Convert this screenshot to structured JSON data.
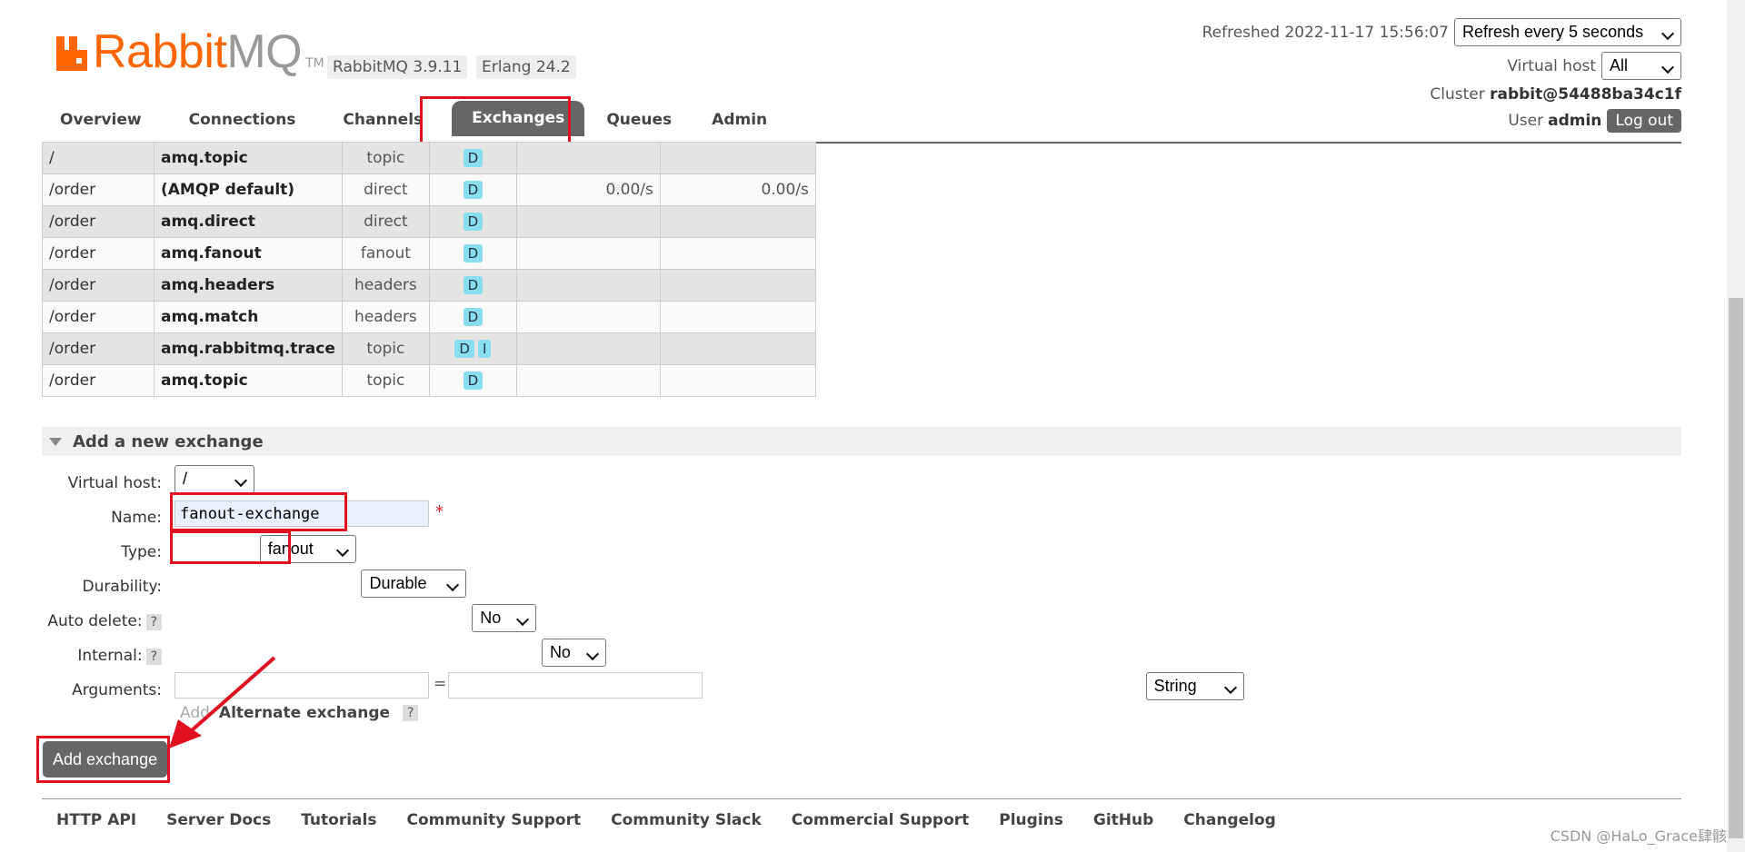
{
  "header": {
    "logo_rabbit": "Rabbit",
    "logo_mq": "MQ",
    "logo_tm": "TM",
    "version_badge": "RabbitMQ 3.9.11",
    "erlang_badge": "Erlang 24.2",
    "refreshed_label": "Refreshed 2022-11-17 15:56:07",
    "refresh_select": "Refresh every 5 seconds",
    "virtual_host_label": "Virtual host",
    "virtual_host_value": "All",
    "cluster_label": "Cluster",
    "cluster_value": "rabbit@54488ba34c1f",
    "user_label": "User",
    "user_value": "admin",
    "logout_label": "Log out"
  },
  "tabs": [
    {
      "label": "Overview",
      "active": false
    },
    {
      "label": "Connections",
      "active": false
    },
    {
      "label": "Channels",
      "active": false
    },
    {
      "label": "Exchanges",
      "active": true
    },
    {
      "label": "Queues",
      "active": false
    },
    {
      "label": "Admin",
      "active": false
    }
  ],
  "exchanges": {
    "rows": [
      {
        "vhost": "/",
        "name": "amq.topic",
        "type": "topic",
        "features": [
          "D"
        ],
        "rate_in": "",
        "rate_out": ""
      },
      {
        "vhost": "/order",
        "name": "(AMQP default)",
        "type": "direct",
        "features": [
          "D"
        ],
        "rate_in": "0.00/s",
        "rate_out": "0.00/s"
      },
      {
        "vhost": "/order",
        "name": "amq.direct",
        "type": "direct",
        "features": [
          "D"
        ],
        "rate_in": "",
        "rate_out": ""
      },
      {
        "vhost": "/order",
        "name": "amq.fanout",
        "type": "fanout",
        "features": [
          "D"
        ],
        "rate_in": "",
        "rate_out": ""
      },
      {
        "vhost": "/order",
        "name": "amq.headers",
        "type": "headers",
        "features": [
          "D"
        ],
        "rate_in": "",
        "rate_out": ""
      },
      {
        "vhost": "/order",
        "name": "amq.match",
        "type": "headers",
        "features": [
          "D"
        ],
        "rate_in": "",
        "rate_out": ""
      },
      {
        "vhost": "/order",
        "name": "amq.rabbitmq.trace",
        "type": "topic",
        "features": [
          "D",
          "I"
        ],
        "rate_in": "",
        "rate_out": ""
      },
      {
        "vhost": "/order",
        "name": "amq.topic",
        "type": "topic",
        "features": [
          "D"
        ],
        "rate_in": "",
        "rate_out": ""
      }
    ]
  },
  "add_exchange": {
    "section_title": "Add a new exchange",
    "virtual_host_label": "Virtual host:",
    "virtual_host_value": "/",
    "name_label": "Name:",
    "name_value": "fanout-exchange",
    "required_mark": "*",
    "type_label": "Type:",
    "type_value": "fanout",
    "durability_label": "Durability:",
    "durability_value": "Durable",
    "auto_delete_label": "Auto delete:",
    "auto_delete_value": "No",
    "internal_label": "Internal:",
    "internal_value": "No",
    "help_mark": "?",
    "arguments_label": "Arguments:",
    "arguments_equals": "=",
    "arguments_type": "String",
    "add_hint": "Add",
    "alternate_exchange_label": "Alternate exchange",
    "submit_label": "Add exchange"
  },
  "footer": {
    "links": [
      "HTTP API",
      "Server Docs",
      "Tutorials",
      "Community Support",
      "Community Slack",
      "Commercial Support",
      "Plugins",
      "GitHub",
      "Changelog"
    ]
  },
  "watermark": "CSDN @HaLo_Grace肆骸",
  "colors": {
    "brand_orange": "#ff6600",
    "tab_active": "#666666",
    "highlight_red": "#e01020",
    "feature_badge": "#88ddee"
  }
}
